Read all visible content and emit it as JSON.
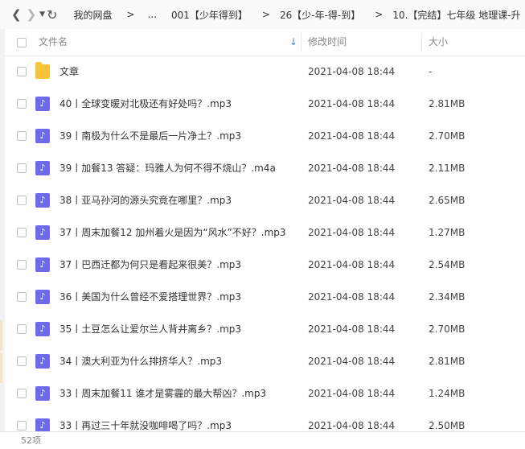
{
  "toolbar": {
    "back_icon": "chevron-left",
    "forward_icon": "chevron-right",
    "dropdown_icon": "caret-down",
    "refresh_icon": "refresh",
    "breadcrumbs": [
      "我的网盘",
      "...",
      "001【少年得到】",
      "26【少-年-得-到】",
      "10.【完结】七年级 地理课-升"
    ],
    "crumb_separator": ">"
  },
  "columns": {
    "name": "文件名",
    "modified": "修改时间",
    "size": "大小"
  },
  "files": [
    {
      "type": "folder",
      "name": "文章",
      "modified": "2021-04-08 18:44",
      "size": "-"
    },
    {
      "type": "audio",
      "name": "40丨全球变暖对北极还有好处吗？.mp3",
      "modified": "2021-04-08 18:44",
      "size": "2.81MB"
    },
    {
      "type": "audio",
      "name": "39丨南极为什么不是最后一片净土？.mp3",
      "modified": "2021-04-08 18:44",
      "size": "2.70MB"
    },
    {
      "type": "audio",
      "name": "39丨加餐13 答疑：玛雅人为何不得不烧山？.m4a",
      "modified": "2021-04-08 18:44",
      "size": "2.11MB"
    },
    {
      "type": "audio",
      "name": "38丨亚马孙河的源头究竟在哪里？.mp3",
      "modified": "2021-04-08 18:44",
      "size": "2.65MB"
    },
    {
      "type": "audio",
      "name": "37丨周末加餐12 加州着火是因为“风水”不好？.mp3",
      "modified": "2021-04-08 18:44",
      "size": "1.27MB"
    },
    {
      "type": "audio",
      "name": "37丨巴西迁都为何只是看起来很美？.mp3",
      "modified": "2021-04-08 18:44",
      "size": "2.54MB"
    },
    {
      "type": "audio",
      "name": "36丨美国为什么曾经不爱搭理世界？.mp3",
      "modified": "2021-04-08 18:44",
      "size": "2.34MB"
    },
    {
      "type": "audio",
      "name": "35丨土豆怎么让爱尔兰人背井离乡？.mp3",
      "modified": "2021-04-08 18:44",
      "size": "2.70MB"
    },
    {
      "type": "audio",
      "name": "34丨澳大利亚为什么排挤华人？.mp3",
      "modified": "2021-04-08 18:44",
      "size": "2.81MB"
    },
    {
      "type": "audio",
      "name": "33丨周末加餐11 谁才是雾霾的最大帮凶？.mp3",
      "modified": "2021-04-08 18:44",
      "size": "1.24MB"
    },
    {
      "type": "audio",
      "name": "33丨再过三十年就没咖啡喝了吗？.mp3",
      "modified": "2021-04-08 18:44",
      "size": "2.50MB"
    }
  ],
  "status": {
    "count": "52项"
  },
  "colors": {
    "folder": "#f7c33b",
    "audio": "#6d6be6",
    "sort_accent": "#3b8fe0"
  }
}
